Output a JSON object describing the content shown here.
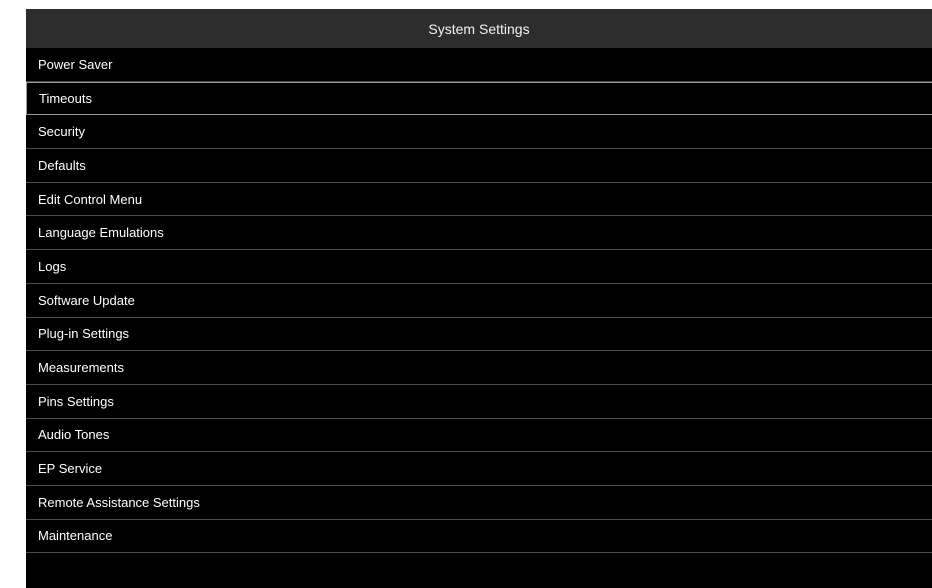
{
  "app": {
    "title": "System Settings"
  },
  "menu": {
    "selected_index": 1,
    "items": [
      {
        "label": "Power Saver"
      },
      {
        "label": "Timeouts"
      },
      {
        "label": "Security"
      },
      {
        "label": "Defaults"
      },
      {
        "label": "Edit Control Menu"
      },
      {
        "label": "Language Emulations"
      },
      {
        "label": "Logs"
      },
      {
        "label": "Software Update"
      },
      {
        "label": "Plug-in Settings"
      },
      {
        "label": "Measurements"
      },
      {
        "label": "Pins Settings"
      },
      {
        "label": "Audio Tones"
      },
      {
        "label": "EP Service"
      },
      {
        "label": "Remote Assistance Settings"
      },
      {
        "label": "Maintenance"
      }
    ]
  },
  "colors": {
    "background": "#000000",
    "title_bar": "#2d2d2d",
    "divider": "#4d4d4d",
    "text": "#ffffff"
  }
}
